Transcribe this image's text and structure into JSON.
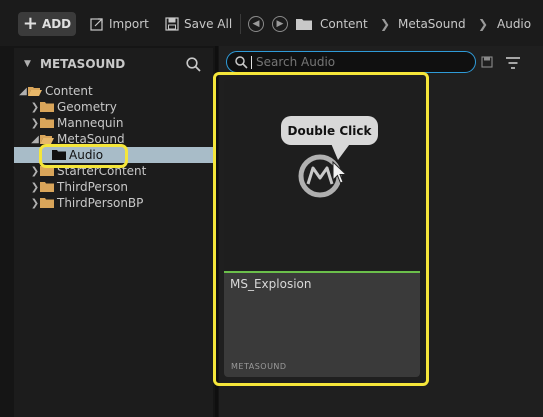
{
  "toolbar": {
    "add_label": "ADD",
    "import_label": "Import",
    "save_all_label": "Save All",
    "breadcrumb": [
      "Content",
      "MetaSound",
      "Audio"
    ]
  },
  "sidebar": {
    "title": "METASOUND",
    "root": "Content",
    "folders": [
      "Geometry",
      "Mannequin",
      "MetaSound",
      "Audio",
      "StarterContent",
      "ThirdPerson",
      "ThirdPersonBP"
    ],
    "selected": "Audio"
  },
  "search": {
    "placeholder": "Search Audio"
  },
  "asset": {
    "name": "MS_Explosion",
    "type": "METASOUND"
  },
  "tooltip": {
    "label": "Double Click"
  },
  "colors": {
    "highlight": "#f5e63a",
    "search_border": "#2f9bd8",
    "asset_accent": "#6bbf4b",
    "selected_row": "#a8bcc8"
  }
}
